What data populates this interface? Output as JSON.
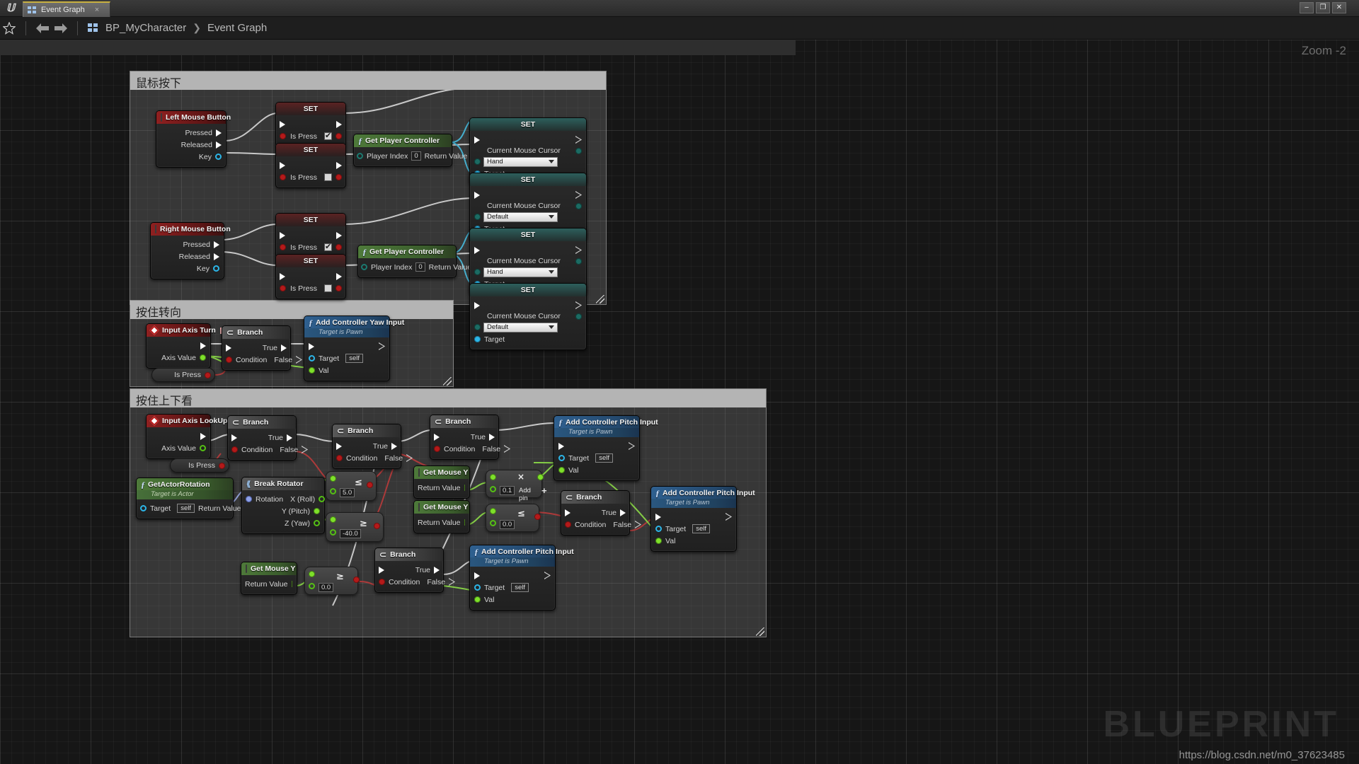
{
  "window": {
    "tab_label": "Event Graph",
    "tab_close": "×",
    "minimize": "–",
    "maximize": "❐",
    "close": "✕"
  },
  "toolbar": {
    "breadcrumb_root": "BP_MyCharacter",
    "breadcrumb_sep": "❯",
    "breadcrumb_leaf": "Event Graph"
  },
  "graph": {
    "zoom_label": "Zoom -2",
    "watermark": "BLUEPRINT",
    "watermark_url": "https://blog.csdn.net/m0_37623485"
  },
  "comments": [
    {
      "title": "鼠标按下"
    },
    {
      "title": "按住转向"
    },
    {
      "title": "按住上下看"
    }
  ],
  "nodes": {
    "left_mouse_button": {
      "title": "Left Mouse Button",
      "pressed": "Pressed",
      "released": "Released",
      "key": "Key"
    },
    "right_mouse_button": {
      "title": "Right Mouse Button",
      "pressed": "Pressed",
      "released": "Released",
      "key": "Key"
    },
    "set_ispress": {
      "title": "SET",
      "label": "Is Press"
    },
    "get_player_controller": {
      "title": "Get Player Controller",
      "player_index": "Player Index",
      "player_index_value": "0",
      "return_value": "Return Value"
    },
    "set_cursor": {
      "title": "SET",
      "label": "Current Mouse Cursor",
      "target": "Target"
    },
    "cursor_values": {
      "hand": "Hand",
      "default": "Default"
    },
    "input_axis_turn": {
      "title": "Input Axis Turn",
      "axis_value": "Axis Value"
    },
    "input_axis_lookup": {
      "title": "Input Axis LookUp",
      "axis_value": "Axis Value"
    },
    "branch": {
      "title": "Branch",
      "condition": "Condition",
      "true": "True",
      "false": "False"
    },
    "is_press_var": {
      "label": "Is Press"
    },
    "add_controller_yaw_input": {
      "title": "Add Controller Yaw Input",
      "subtitle": "Target is Pawn",
      "target": "Target",
      "target_value": "self",
      "val": "Val"
    },
    "add_controller_pitch_input": {
      "title": "Add Controller Pitch Input",
      "subtitle": "Target is Pawn",
      "target": "Target",
      "target_value": "self",
      "val": "Val"
    },
    "get_actor_rotation": {
      "title": "GetActorRotation",
      "subtitle": "Target is Actor",
      "target": "Target",
      "target_value": "self",
      "return_value": "Return Value"
    },
    "break_rotator": {
      "title": "Break Rotator",
      "rotation": "Rotation",
      "x_roll": "X (Roll)",
      "y_pitch": "Y (Pitch)",
      "z_yaw": "Z (Yaw)"
    },
    "get_mouse_y": {
      "title": "Get Mouse Y",
      "return_value": "Return Value"
    },
    "compare_le_5": {
      "operator": "≤",
      "value": "5.0"
    },
    "compare_ge_40": {
      "operator": "≥",
      "value": "-40.0"
    },
    "multiply_01": {
      "operator": "×",
      "value": "0.1",
      "add_pin": "Add pin",
      "plus": "+"
    },
    "compare_le_0": {
      "operator": "≤",
      "value": "0.0"
    },
    "compare_ge_0": {
      "operator": "≥",
      "value": "0.0"
    }
  },
  "icons": {
    "ue_logo": "unreal-logo-icon",
    "star": "star-icon",
    "back": "back-arrow-icon",
    "forward": "forward-arrow-icon",
    "blueprint": "blueprint-icon",
    "mouse": "mouse-icon",
    "function": "function-icon",
    "branch": "branch-icon"
  },
  "colors": {
    "exec_wire": "#d9d9d9",
    "object_wire": "#29b6e0",
    "bool_wire": "#b41a1a",
    "float_wire": "#7ee02a",
    "struct_wire": "#8fa2e8",
    "accent_tab": "#c8b040"
  }
}
